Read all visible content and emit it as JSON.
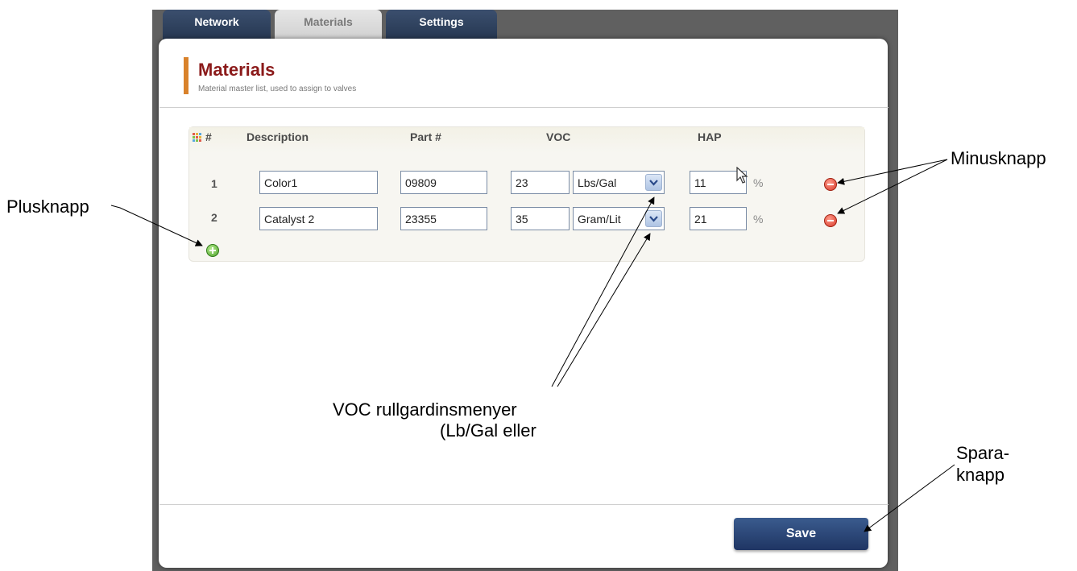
{
  "tabs": [
    {
      "label": "Network"
    },
    {
      "label": "Materials"
    },
    {
      "label": "Settings"
    }
  ],
  "page": {
    "title": "Materials",
    "subtitle": "Material master list, used to assign to valves"
  },
  "table": {
    "headers": {
      "num": "#",
      "description": "Description",
      "part": "Part #",
      "voc": "VOC",
      "hap": "HAP"
    },
    "rows": [
      {
        "num": "1",
        "description": "Color1",
        "part": "09809",
        "voc": "23",
        "voc_unit": "Lbs/Gal",
        "hap": "11",
        "hap_unit": "%"
      },
      {
        "num": "2",
        "description": "Catalyst 2",
        "part": "23355",
        "voc": "35",
        "voc_unit": "Gram/Lit",
        "hap": "21",
        "hap_unit": "%"
      }
    ]
  },
  "buttons": {
    "save_label": "Save"
  },
  "icons": {
    "grid": "grid-icon",
    "add": "plus-circle-icon",
    "remove": "minus-circle-icon",
    "dropdown": "chevron-down-icon"
  },
  "annotations": {
    "plus": "Plusknapp",
    "minus": "Minusknapp",
    "voc_line1": "VOC rullgardinsmenyer",
    "voc_line2": "(Lb/Gal eller",
    "save_line1": "Spara-",
    "save_line2": "knapp"
  },
  "colors": {
    "title": "#8b1a1a",
    "accent": "#d9822b",
    "tab_dark": "#2b3d5b",
    "save_button": "#2a4577"
  }
}
